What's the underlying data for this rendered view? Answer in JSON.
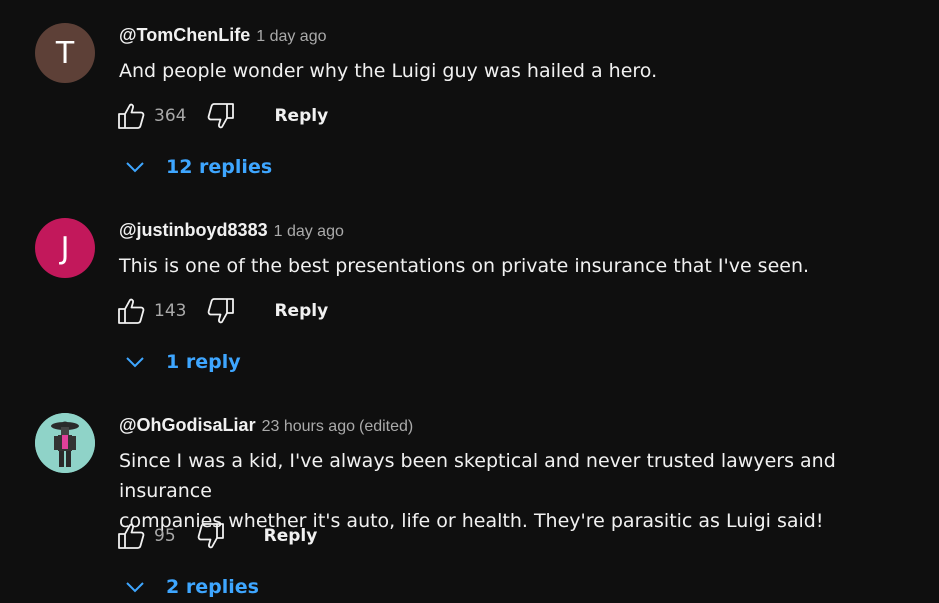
{
  "comments": [
    {
      "avatar_letter": "T",
      "avatar_color": "#5d4037",
      "author": "@TomChenLife",
      "time": "1 day ago",
      "edited": "",
      "text": "And people wonder why the Luigi guy was hailed a hero.",
      "likes": "364",
      "reply_label": "Reply",
      "replies_label": "12 replies"
    },
    {
      "avatar_letter": "J",
      "avatar_color": "#c2185b",
      "author": "@justinboyd8383",
      "time": "1 day ago",
      "edited": "",
      "text": "This is one of the best presentations on private insurance that I've seen.",
      "likes": "143",
      "reply_label": "Reply",
      "replies_label": "1 reply"
    },
    {
      "avatar_letter": "",
      "avatar_color": "#8fd3c8",
      "author": "@OhGodisaLiar",
      "time": "23 hours ago",
      "edited": "(edited)",
      "text_line1": "Since I was a kid, I've always been skeptical and never trusted lawyers and insurance",
      "text_line2": "companies whether it's auto, life or health. They're parasitic as Luigi said!",
      "likes": "95",
      "reply_label": "Reply",
      "replies_label": "2 replies"
    }
  ],
  "icons": {
    "like": "thumbs-up-icon",
    "dislike": "thumbs-down-icon",
    "expand": "chevron-down-icon"
  },
  "colors": {
    "background": "#0f0f0f",
    "link_blue": "#3ea6ff",
    "secondary_text": "#aaaaaa"
  }
}
